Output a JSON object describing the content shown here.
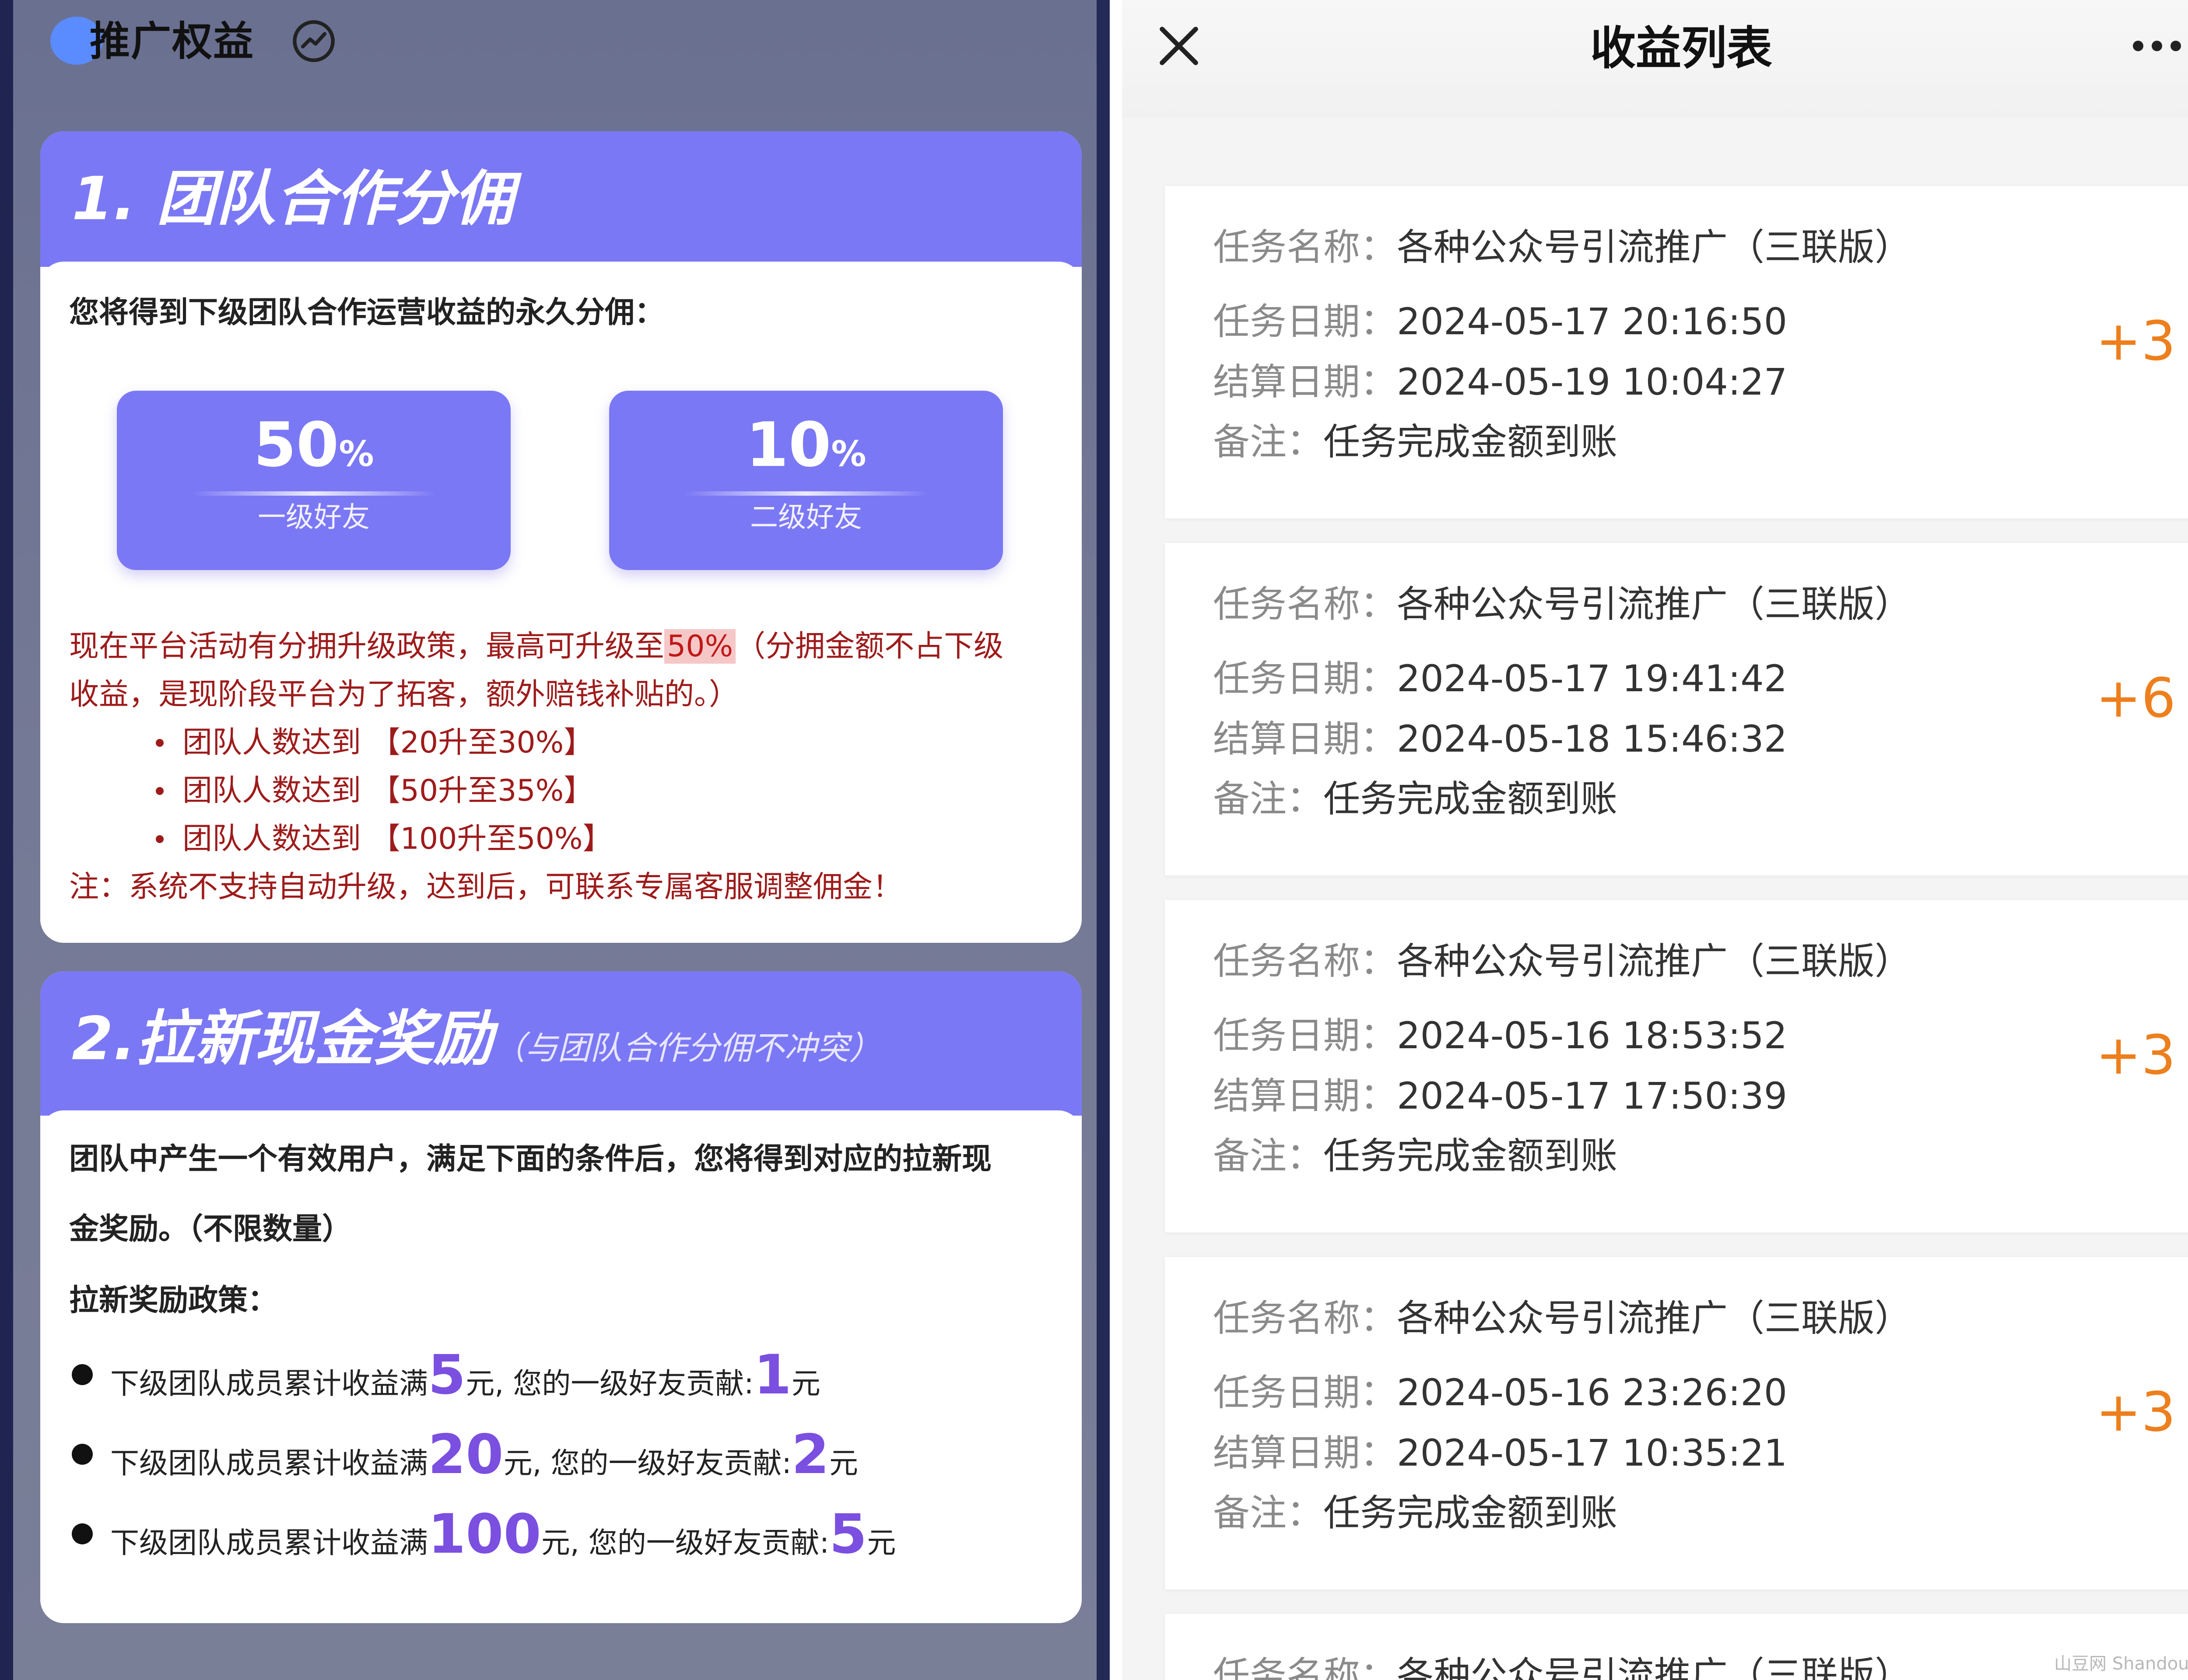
{
  "left": {
    "header_title": "推广权益",
    "section1": {
      "title": "1. 团队合作分佣",
      "intro": "您将得到下级团队合作运营收益的永久分佣：",
      "stats": [
        {
          "value": "50",
          "unit": "%",
          "label": "一级好友"
        },
        {
          "value": "10",
          "unit": "%",
          "label": "二级好友"
        }
      ],
      "policy_line1_a": "现在平台活动有分拥升级政策，最高可升级至",
      "policy_line1_highlight": "50%",
      "policy_line1_b": "（分拥金额不占下级",
      "policy_line2": "收益，是现阶段平台为了拓客，额外赔钱补贴的。）",
      "bullets": [
        "团队人数达到 【20升至30%】",
        "团队人数达到 【50升至35%】",
        "团队人数达到 【100升至50%】"
      ],
      "note": "注：系统不支持自动升级，达到后，可联系专属客服调整佣金！"
    },
    "section2": {
      "title": "2.拉新现金奖励",
      "subtitle": "（与团队合作分佣不冲突）",
      "intro_line1": "团队中产生一个有效用户，满足下面的条件后，您将得到对应的拉新现",
      "intro_line2": "金奖励。（不限数量）",
      "policy_title": "拉新奖励政策：",
      "rewards": [
        {
          "prefix": "下级团队成员累计收益满",
          "amount": "5",
          "mid": "元, 您的一级好友贡献:",
          "bonus": "1",
          "suffix": "元"
        },
        {
          "prefix": "下级团队成员累计收益满",
          "amount": "20",
          "mid": "元, 您的一级好友贡献:",
          "bonus": "2",
          "suffix": "元"
        },
        {
          "prefix": "下级团队成员累计收益满",
          "amount": "100",
          "mid": "元, 您的一级好友贡献:",
          "bonus": "5",
          "suffix": "元"
        }
      ]
    }
  },
  "right": {
    "page_title": "收益列表",
    "labels": {
      "task_name": "任务名称：",
      "task_date": "任务日期：",
      "settle_date": "结算日期：",
      "remark": "备注："
    },
    "items": [
      {
        "task_name": "各种公众号引流推广（三联版）",
        "task_date": "2024-05-17 20:16:50",
        "settle_date": "2024-05-19 10:04:27",
        "remark": "任务完成金额到账",
        "amount": "+3"
      },
      {
        "task_name": "各种公众号引流推广（三联版）",
        "task_date": "2024-05-17 19:41:42",
        "settle_date": "2024-05-18 15:46:32",
        "remark": "任务完成金额到账",
        "amount": "+6"
      },
      {
        "task_name": "各种公众号引流推广（三联版）",
        "task_date": "2024-05-16 18:53:52",
        "settle_date": "2024-05-17 17:50:39",
        "remark": "任务完成金额到账",
        "amount": "+3"
      },
      {
        "task_name": "各种公众号引流推广（三联版）",
        "task_date": "2024-05-16 23:26:20",
        "settle_date": "2024-05-17 10:35:21",
        "remark": "任务完成金额到账",
        "amount": "+3"
      },
      {
        "task_name": "各种公众号引流推广（三联版）"
      }
    ],
    "watermark": "山豆网 Shandou.net"
  },
  "colors": {
    "accent_purple": "#7b78f5",
    "alert_red": "#9e1b1b",
    "amount_orange": "#ed7f1d",
    "reward_purple": "#7b4fe0"
  },
  "icons": {
    "header": "trend-icon",
    "close": "close-icon",
    "more": "more-icon"
  }
}
